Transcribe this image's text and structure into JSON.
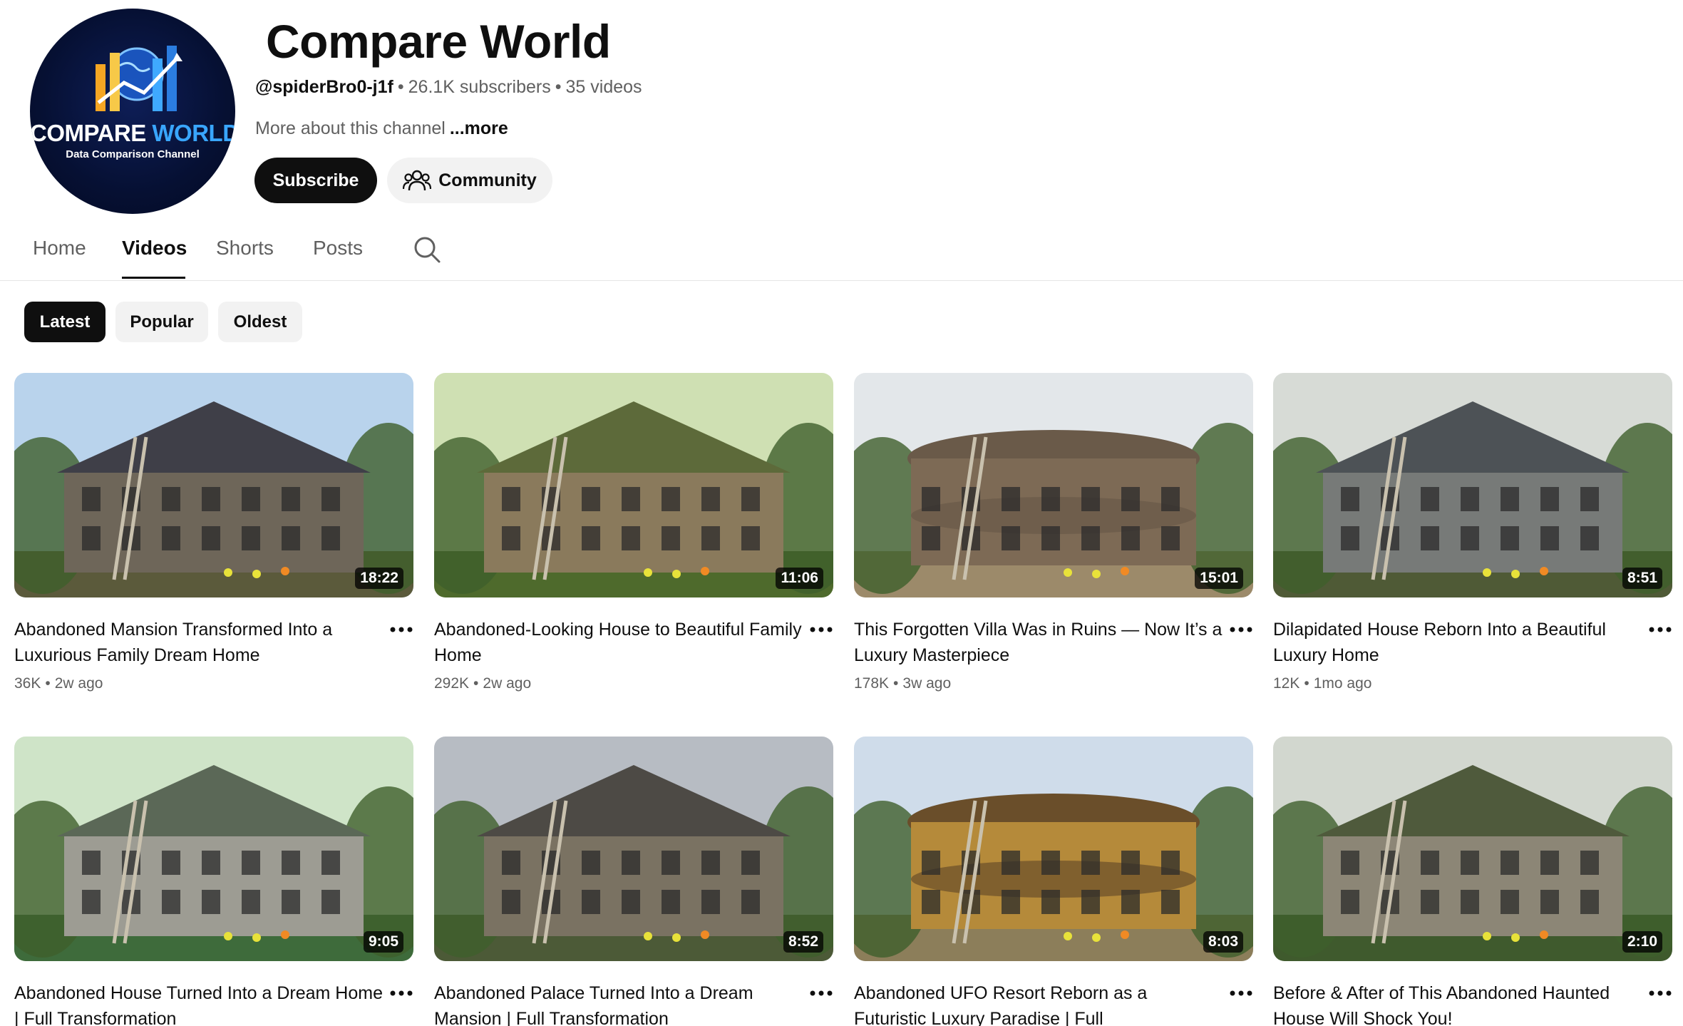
{
  "channel": {
    "name": "Compare World",
    "handle": "@spiderBro0-j1f",
    "subscribers": "26.1K subscribers",
    "videos_count": "35 videos",
    "about": "More about this channel",
    "more_label": "...more",
    "avatar": {
      "logo_title_a": "COMPARE ",
      "logo_title_b": "WORLD",
      "logo_subtitle": "Data Comparison Channel",
      "bg_color": "#061033",
      "accent_color": "#39a6ff"
    },
    "subscribe_label": "Subscribe",
    "community_label": "Community"
  },
  "tabs": [
    {
      "label": "Home"
    },
    {
      "label": "Videos"
    },
    {
      "label": "Shorts"
    },
    {
      "label": "Posts"
    }
  ],
  "active_tab": "Videos",
  "filters": [
    {
      "label": "Latest"
    },
    {
      "label": "Popular"
    },
    {
      "label": "Oldest"
    }
  ],
  "active_filter": "Latest",
  "videos": [
    {
      "title": "Abandoned Mansion Transformed Into a Luxurious Family Dream Home",
      "duration": "18:22",
      "views": "36K",
      "age": "2w ago",
      "sky": "#b9d3ec",
      "ground": "#5b5a3b",
      "building": "#6e6659",
      "roof": "#3f3f48"
    },
    {
      "title": "Abandoned-Looking House to Beautiful Family Home",
      "duration": "11:06",
      "views": "292K",
      "age": "2w ago",
      "sky": "#cfe0b3",
      "ground": "#4e6a2c",
      "building": "#8a7a5c",
      "roof": "#5d6a3a"
    },
    {
      "title": "This Forgotten Villa Was in Ruins — Now It’s a Luxury Masterpiece",
      "duration": "15:01",
      "views": "178K",
      "age": "3w ago",
      "sky": "#e3e7ea",
      "ground": "#9c8a6a",
      "building": "#7d6a55",
      "roof": "#6a5a49"
    },
    {
      "title": "Dilapidated House Reborn Into a Beautiful Luxury Home",
      "duration": "8:51",
      "views": "12K",
      "age": "1mo ago",
      "sky": "#d7dbd6",
      "ground": "#4f5a36",
      "building": "#777a78",
      "roof": "#4d5256"
    },
    {
      "title": "Abandoned House Turned Into a Dream Home | Full Transformation",
      "duration": "9:05",
      "views": "",
      "age": "",
      "sky": "#cfe4c8",
      "ground": "#3e6b3b",
      "building": "#9d9c93",
      "roof": "#5b6857"
    },
    {
      "title": "Abandoned Palace Turned Into a Dream Mansion | Full Transformation",
      "duration": "8:52",
      "views": "",
      "age": "",
      "sky": "#b7bcc3",
      "ground": "#4c5a37",
      "building": "#7a7262",
      "roof": "#4d4a45"
    },
    {
      "title": "Abandoned UFO Resort Reborn as a Futuristic Luxury Paradise | Full Transformation",
      "duration": "8:03",
      "views": "",
      "age": "",
      "sky": "#cfdcea",
      "ground": "#8c7e5a",
      "building": "#b58a3a",
      "roof": "#6a4e2a"
    },
    {
      "title": "Before & After of This Abandoned Haunted House Will Shock You!",
      "duration": "2:10",
      "views": "",
      "age": "",
      "sky": "#d2d7cf",
      "ground": "#3f5a2d",
      "building": "#8c8676",
      "roof": "#4f5a3c"
    }
  ]
}
